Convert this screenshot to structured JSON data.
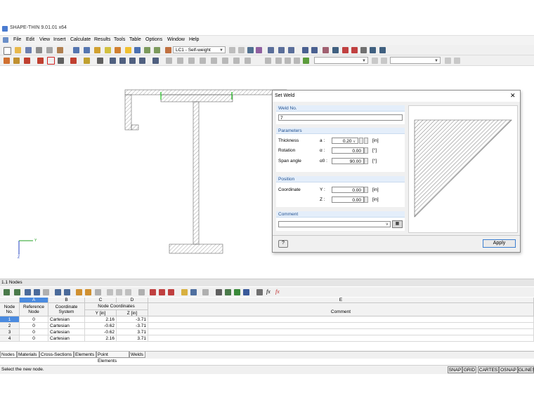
{
  "app": {
    "title": "SHAPE-THIN 9.01.01 x64"
  },
  "menu": [
    "File",
    "Edit",
    "View",
    "Insert",
    "Calculate",
    "Results",
    "Tools",
    "Table",
    "Options",
    "Window",
    "Help"
  ],
  "toolbar": {
    "loadcase": "LC1 - Self-weight"
  },
  "dialog": {
    "title": "Set Weld",
    "weld_no_header": "Weld No.",
    "weld_no": "7",
    "parameters_header": "Parameters",
    "thickness_label": "Thickness",
    "thickness_symbol": "a :",
    "thickness_value": "0.20",
    "thickness_unit": "[in]",
    "rotation_label": "Rotation",
    "rotation_symbol": "α :",
    "rotation_value": "0.00",
    "rotation_unit": "[°]",
    "span_label": "Span angle",
    "span_symbol": "α0 :",
    "span_value": "90.00",
    "span_unit": "[°]",
    "position_header": "Position",
    "coordinate_label": "Coordinate",
    "y_symbol": "Y :",
    "y_value": "0.00",
    "y_unit": "[in]",
    "z_symbol": "Z :",
    "z_value": "0.00",
    "z_unit": "[in]",
    "comment_header": "Comment",
    "comment_value": "",
    "apply_label": "Apply"
  },
  "axes": {
    "y": "Y",
    "z": "Z"
  },
  "panel": {
    "title": "1.1 Nodes"
  },
  "table": {
    "col_letters": [
      "A",
      "B",
      "C",
      "D",
      "E"
    ],
    "headers": {
      "node_no": "Node No.",
      "ref_node": "Reference Node",
      "coord_sys": "Coordinate System",
      "node_coords": "Node Coordinates",
      "y": "Y [in]",
      "z": "Z [in]",
      "comment": "Comment"
    },
    "rows": [
      {
        "no": "1",
        "ref": "0",
        "sys": "Cartesian",
        "y": "2.16",
        "z": "-3.71"
      },
      {
        "no": "2",
        "ref": "0",
        "sys": "Cartesian",
        "y": "-0.62",
        "z": "-3.71"
      },
      {
        "no": "3",
        "ref": "0",
        "sys": "Cartesian",
        "y": "-0.62",
        "z": "3.71"
      },
      {
        "no": "4",
        "ref": "0",
        "sys": "Cartesian",
        "y": "2.16",
        "z": "3.71"
      }
    ]
  },
  "tabs": [
    "Nodes",
    "Materials",
    "Cross-Sections",
    "Elements",
    "Point Elements",
    "Welds"
  ],
  "status": {
    "message": "Select the new node.",
    "buttons": [
      "SNAP",
      "GRID",
      "CARTES",
      "OSNAP",
      "GLINES"
    ]
  }
}
